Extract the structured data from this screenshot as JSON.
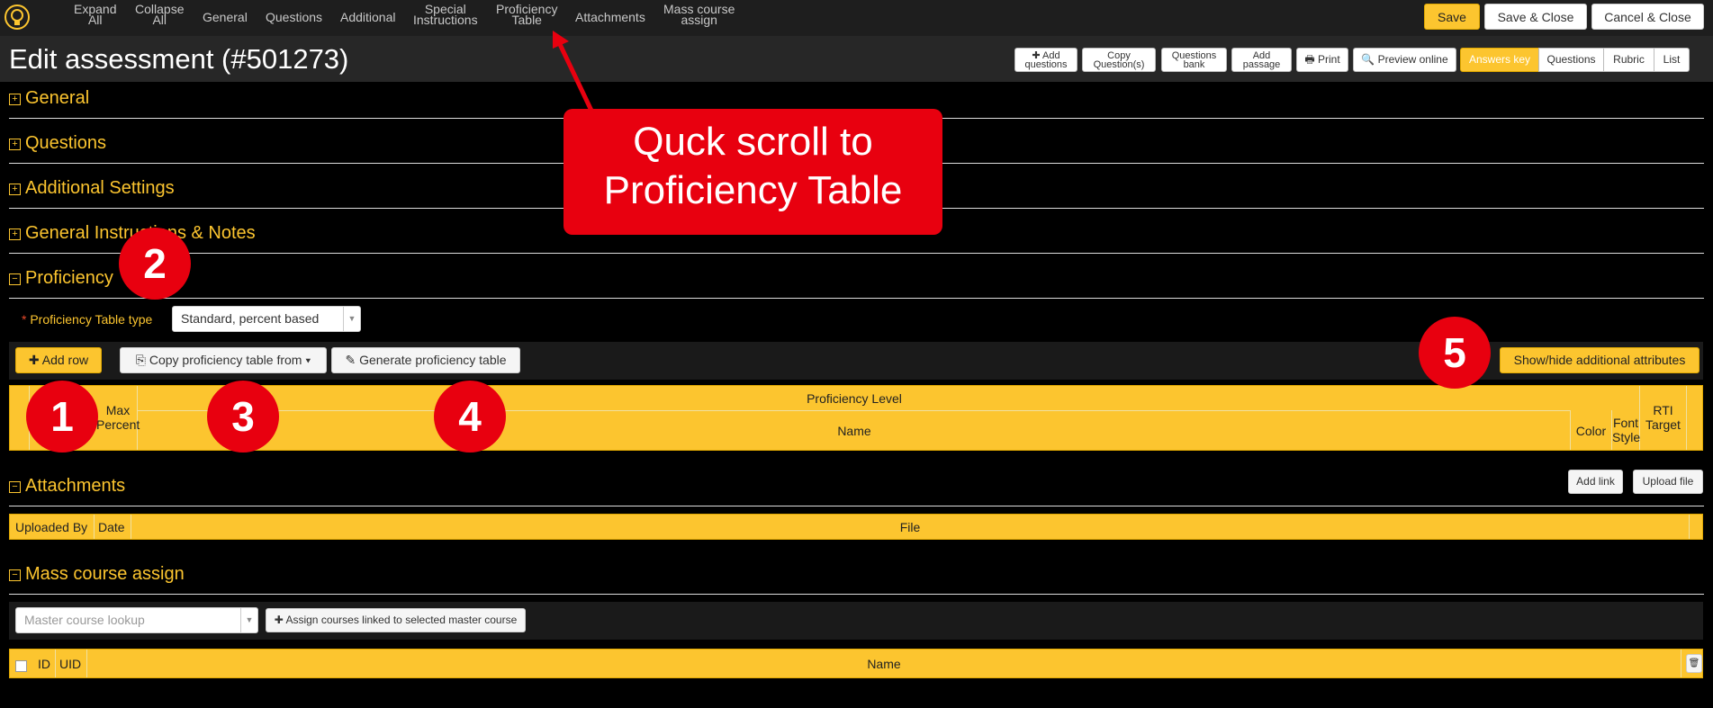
{
  "nav": {
    "expand_all": [
      "Expand",
      "All"
    ],
    "collapse_all": [
      "Collapse",
      "All"
    ],
    "general": "General",
    "questions": "Questions",
    "additional": "Additional",
    "special_instructions": [
      "Special",
      "Instructions"
    ],
    "proficiency_table": [
      "Proficiency",
      "Table"
    ],
    "attachments": "Attachments",
    "mass_course_assign": [
      "Mass course",
      "assign"
    ],
    "save": "Save",
    "save_close": "Save & Close",
    "cancel_close": "Cancel & Close"
  },
  "header": {
    "title": "Edit assessment (#501273)",
    "add_questions": [
      "✚ Add",
      "questions"
    ],
    "copy_questions": [
      "Copy",
      "Question(s)"
    ],
    "questions_bank": [
      "Questions",
      "bank"
    ],
    "add_passage": [
      "Add",
      "passage"
    ],
    "print": "🖶 Print",
    "preview_online": "🔍 Preview online",
    "view_tabs": [
      "Answers key",
      "Questions",
      "Rubric",
      "List"
    ]
  },
  "sections": {
    "general": "General",
    "questions": "Questions",
    "additional_settings": "Additional Settings",
    "general_instructions": "General Instructions & Notes",
    "proficiency": "Proficiency",
    "attachments": "Attachments",
    "mass_course_assign": "Mass course assign"
  },
  "proficiency": {
    "type_label": "Proficiency Table type",
    "type_value": "Standard, percent based",
    "add_row": "✚ Add row",
    "copy_from": "⎘ Copy proficiency table from ▾",
    "generate": "✎ Generate proficiency table",
    "show_hide": "Show/hide additional attributes",
    "columns": {
      "max_percent": [
        "Max",
        "Percent"
      ],
      "proficiency_level": "Proficiency Level",
      "name": "Name",
      "color": "Color",
      "font_style": [
        "Font",
        "Style"
      ],
      "rti_target": [
        "RTI",
        "Target"
      ]
    }
  },
  "attachments": {
    "add_link": "Add link",
    "upload_file": "Upload file",
    "columns": [
      "Uploaded By",
      "Date",
      "File"
    ]
  },
  "mass_course": {
    "lookup_placeholder": "Master course lookup",
    "assign_button": "✚ Assign courses linked to selected master course",
    "columns": [
      "ID",
      "UID",
      "Name"
    ]
  },
  "annotations": {
    "callout": [
      "Quck scroll to",
      "Proficiency Table"
    ],
    "bubbles": [
      "1",
      "2",
      "3",
      "4",
      "5"
    ]
  },
  "colors": {
    "accent": "#fcc52f",
    "annotation_red": "#e8000f"
  }
}
